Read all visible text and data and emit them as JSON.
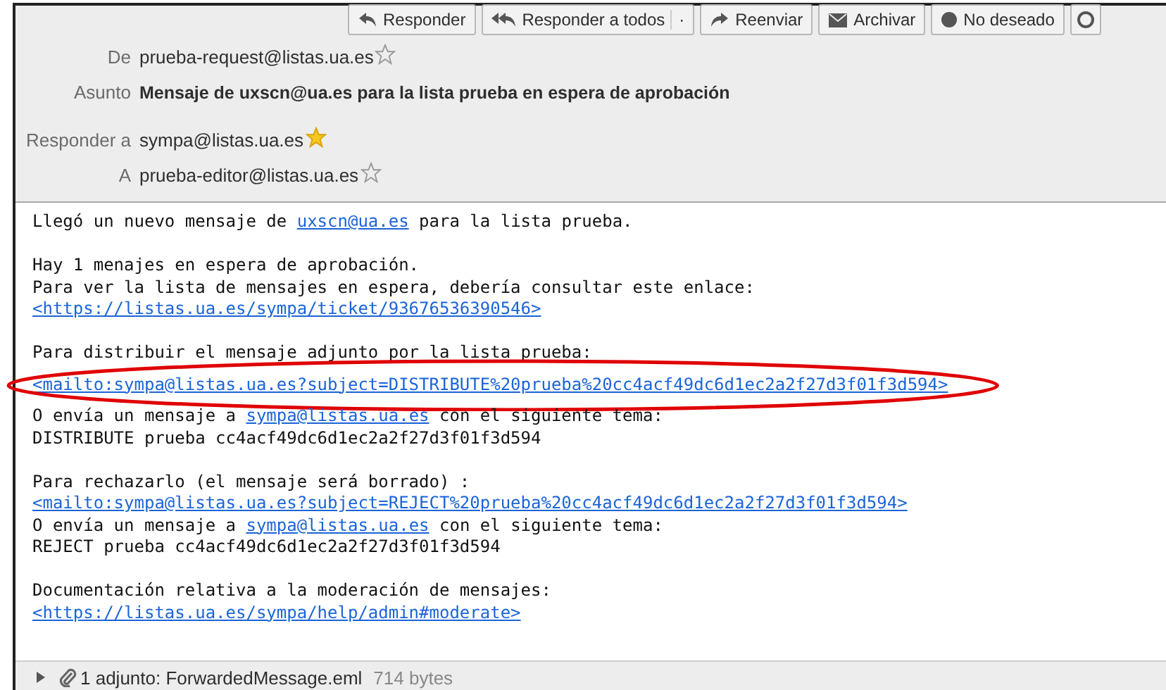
{
  "toolbar": [
    {
      "label": "Responder"
    },
    {
      "label": "Responder a todos",
      "menu": "·"
    },
    {
      "label": "Reenviar"
    },
    {
      "label": "Archivar"
    },
    {
      "label": "No deseado"
    }
  ],
  "headers": [
    {
      "label": "De",
      "value": "prueba-request@listas.ua.es",
      "starred": false,
      "bold": false
    },
    {
      "label": "Asunto",
      "value": "Mensaje de uxscn@ua.es para la lista prueba en espera de aprobación",
      "bold": true
    },
    {
      "label": "Responder a",
      "value": "sympa@listas.ua.es",
      "starred": true,
      "bold": false
    },
    {
      "label": "A",
      "value": "prueba-editor@listas.ua.es",
      "starred": false,
      "bold": false
    }
  ],
  "body": [
    [
      {
        "highlighted": false,
        "segments": [
          {
            "text": "Llegó un nuevo mensaje de ",
            "link": false
          },
          {
            "text": "uxscn@ua.es",
            "link": true
          },
          {
            "text": " para la lista prueba.",
            "link": false
          }
        ]
      }
    ],
    [
      {
        "highlighted": false,
        "segments": [
          {
            "text": "Hay 1 menajes en espera de aprobación.",
            "link": false
          }
        ]
      },
      {
        "highlighted": false,
        "segments": [
          {
            "text": "Para ver la lista de mensajes en espera, debería consultar este enlace:",
            "link": false
          }
        ]
      },
      {
        "highlighted": false,
        "segments": [
          {
            "text": "<https://listas.ua.es/sympa/ticket/93676536390546>",
            "link": true
          }
        ]
      }
    ],
    [
      {
        "highlighted": false,
        "segments": [
          {
            "text": "Para distribuir el mensaje adjunto por la lista prueba:",
            "link": false
          }
        ]
      },
      {
        "highlighted": true,
        "segments": [
          {
            "text": "<mailto:sympa@listas.ua.es?subject=DISTRIBUTE%20prueba%20cc4acf49dc6d1ec2a2f27d3f01f3d594>",
            "link": true
          }
        ]
      },
      {
        "highlighted": false,
        "segments": [
          {
            "text": "O envía un mensaje a ",
            "link": false
          },
          {
            "text": "sympa@listas.ua.es",
            "link": true
          },
          {
            "text": " con el siguiente tema:",
            "link": false
          }
        ]
      },
      {
        "highlighted": false,
        "segments": [
          {
            "text": "DISTRIBUTE prueba cc4acf49dc6d1ec2a2f27d3f01f3d594",
            "link": false
          }
        ]
      }
    ],
    [
      {
        "highlighted": false,
        "segments": [
          {
            "text": "Para rechazarlo (el mensaje será borrado) :",
            "link": false
          }
        ]
      },
      {
        "highlighted": false,
        "segments": [
          {
            "text": "<mailto:sympa@listas.ua.es?subject=REJECT%20prueba%20cc4acf49dc6d1ec2a2f27d3f01f3d594>",
            "link": true
          }
        ]
      },
      {
        "highlighted": false,
        "segments": [
          {
            "text": "O envía un mensaje a ",
            "link": false
          },
          {
            "text": "sympa@listas.ua.es",
            "link": true
          },
          {
            "text": " con el siguiente tema:",
            "link": false
          }
        ]
      },
      {
        "highlighted": false,
        "segments": [
          {
            "text": "REJECT prueba cc4acf49dc6d1ec2a2f27d3f01f3d594",
            "link": false
          }
        ]
      }
    ],
    [
      {
        "highlighted": false,
        "segments": [
          {
            "text": "Documentación relativa a la moderación de mensajes:",
            "link": false
          }
        ]
      },
      {
        "highlighted": false,
        "segments": [
          {
            "text": "<https://listas.ua.es/sympa/help/admin#moderate>",
            "link": true
          }
        ]
      }
    ]
  ],
  "attachment": {
    "expanded": false,
    "label": "1 adjunto: ForwardedMessage.eml",
    "size": "714 bytes"
  }
}
